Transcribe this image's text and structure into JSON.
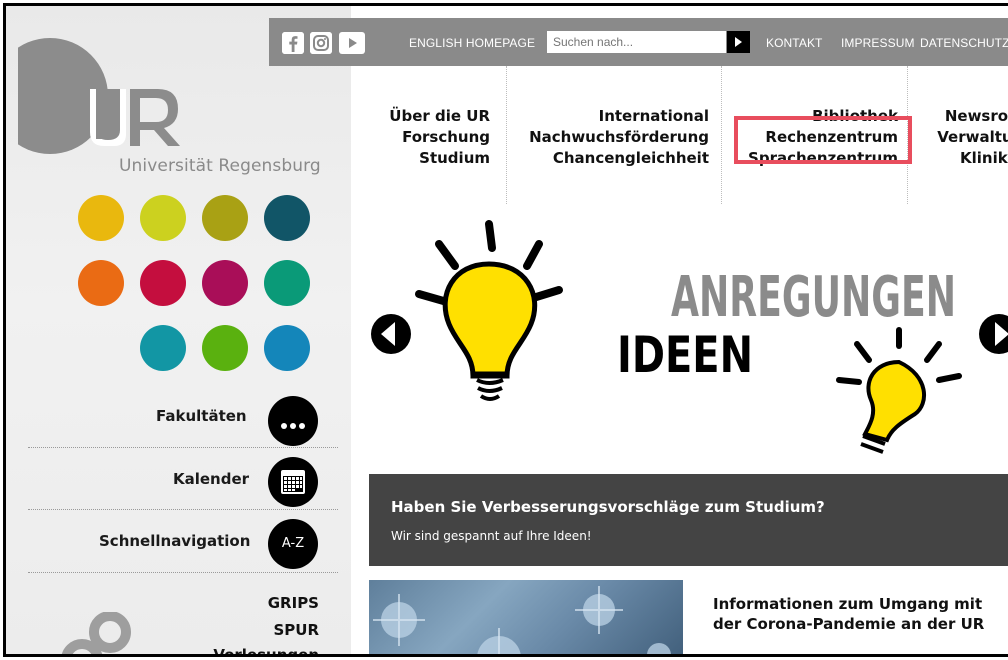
{
  "header": {
    "social": [
      "facebook-icon",
      "instagram-icon",
      "youtube-icon"
    ],
    "links": {
      "english": "ENGLISH HOMEPAGE",
      "kontakt": "KONTAKT",
      "impressum": "IMPRESSUM",
      "datenschutz": "DATENSCHUTZ"
    },
    "search": {
      "placeholder": "Suchen nach..."
    }
  },
  "logo": {
    "initials": "UR",
    "university": "Universität Regensburg"
  },
  "faculty_colors": [
    "#e9b80e",
    "#ccd11f",
    "#a9a114",
    "#115567",
    "#ea6b14",
    "#c40e3e",
    "#a90e58",
    "#0a9a78",
    "#1296a4",
    "#5ab10f",
    "#1486ba"
  ],
  "side_nav": {
    "fakultaeten": "Fakultäten",
    "kalender": "Kalender",
    "schnellnav": "Schnellnavigation",
    "az": "A-Z",
    "quicklinks": [
      "GRIPS",
      "SPUR",
      "Vorlesungen"
    ]
  },
  "main_nav": {
    "col1": [
      "Über die UR",
      "Forschung",
      "Studium"
    ],
    "col2": [
      "International",
      "Nachwuchsförderung",
      "Chancengleichheit"
    ],
    "col3": [
      "Bibliothek",
      "Rechenzentrum",
      "Sprachenzentrum"
    ],
    "col4": [
      "Newsroom",
      "Verwaltung",
      "Klinikum"
    ]
  },
  "banner": {
    "word1": "IDEEN",
    "word2": "ANREGUNGEN",
    "title": "Haben Sie Verbesserungsvorschläge zum Studium?",
    "subtitle": "Wir sind gespannt auf Ihre Ideen!"
  },
  "news": {
    "title": "Informationen zum Umgang mit der Corona-Pandemie an der UR"
  },
  "colors": {
    "topbar": "#8a8a8a",
    "highlight": "#e84d5d",
    "banner_info": "#444444"
  }
}
